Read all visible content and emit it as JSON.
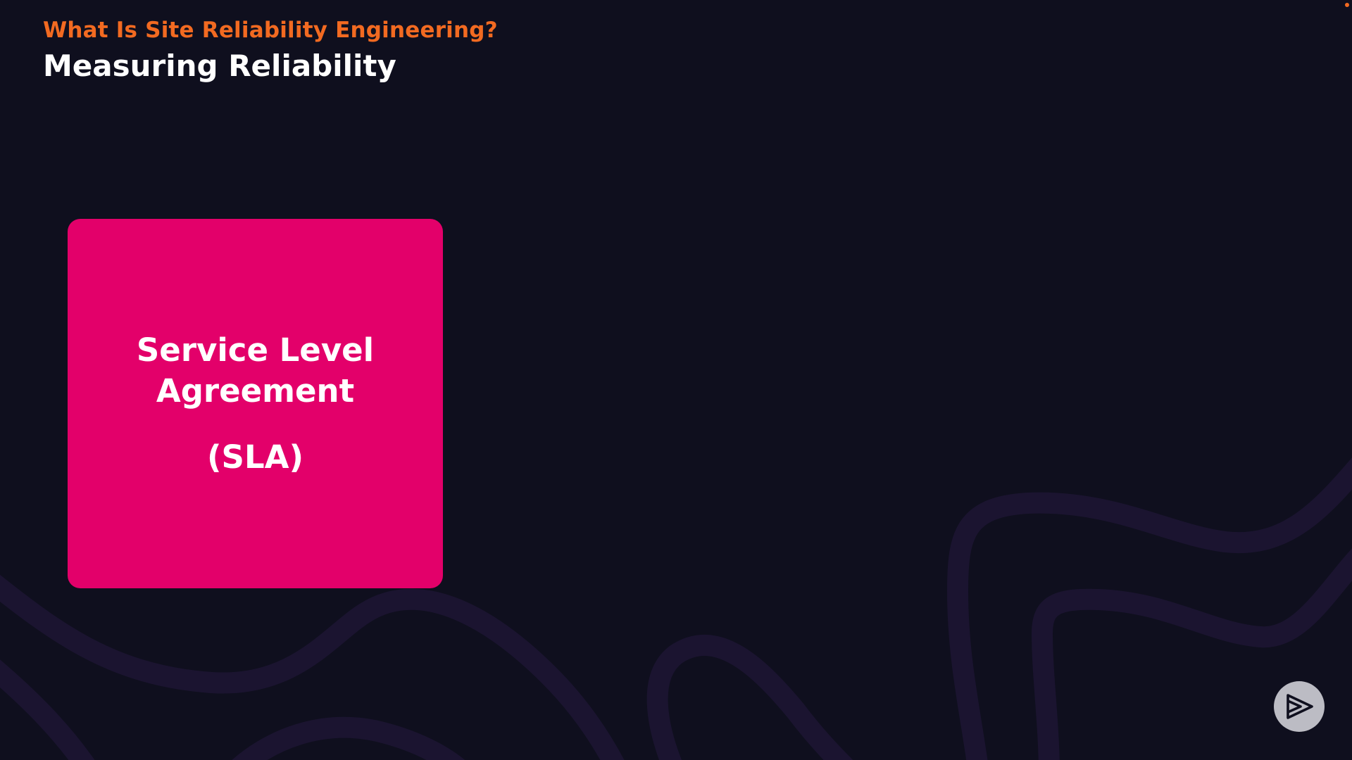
{
  "header": {
    "module_title": "What Is Site Reliability Engineering?",
    "slide_title": "Measuring Reliability"
  },
  "card": {
    "line1": "Service Level",
    "line2": "Agreement",
    "abbreviation": "(SLA)"
  },
  "brand": {
    "icon": "play-logo-icon"
  },
  "colors": {
    "background": "#0f0f1e",
    "module_title": "#f26a21",
    "card": "#e3006a",
    "waves": "#1d1533",
    "brand_button": "#bcbcc4"
  }
}
